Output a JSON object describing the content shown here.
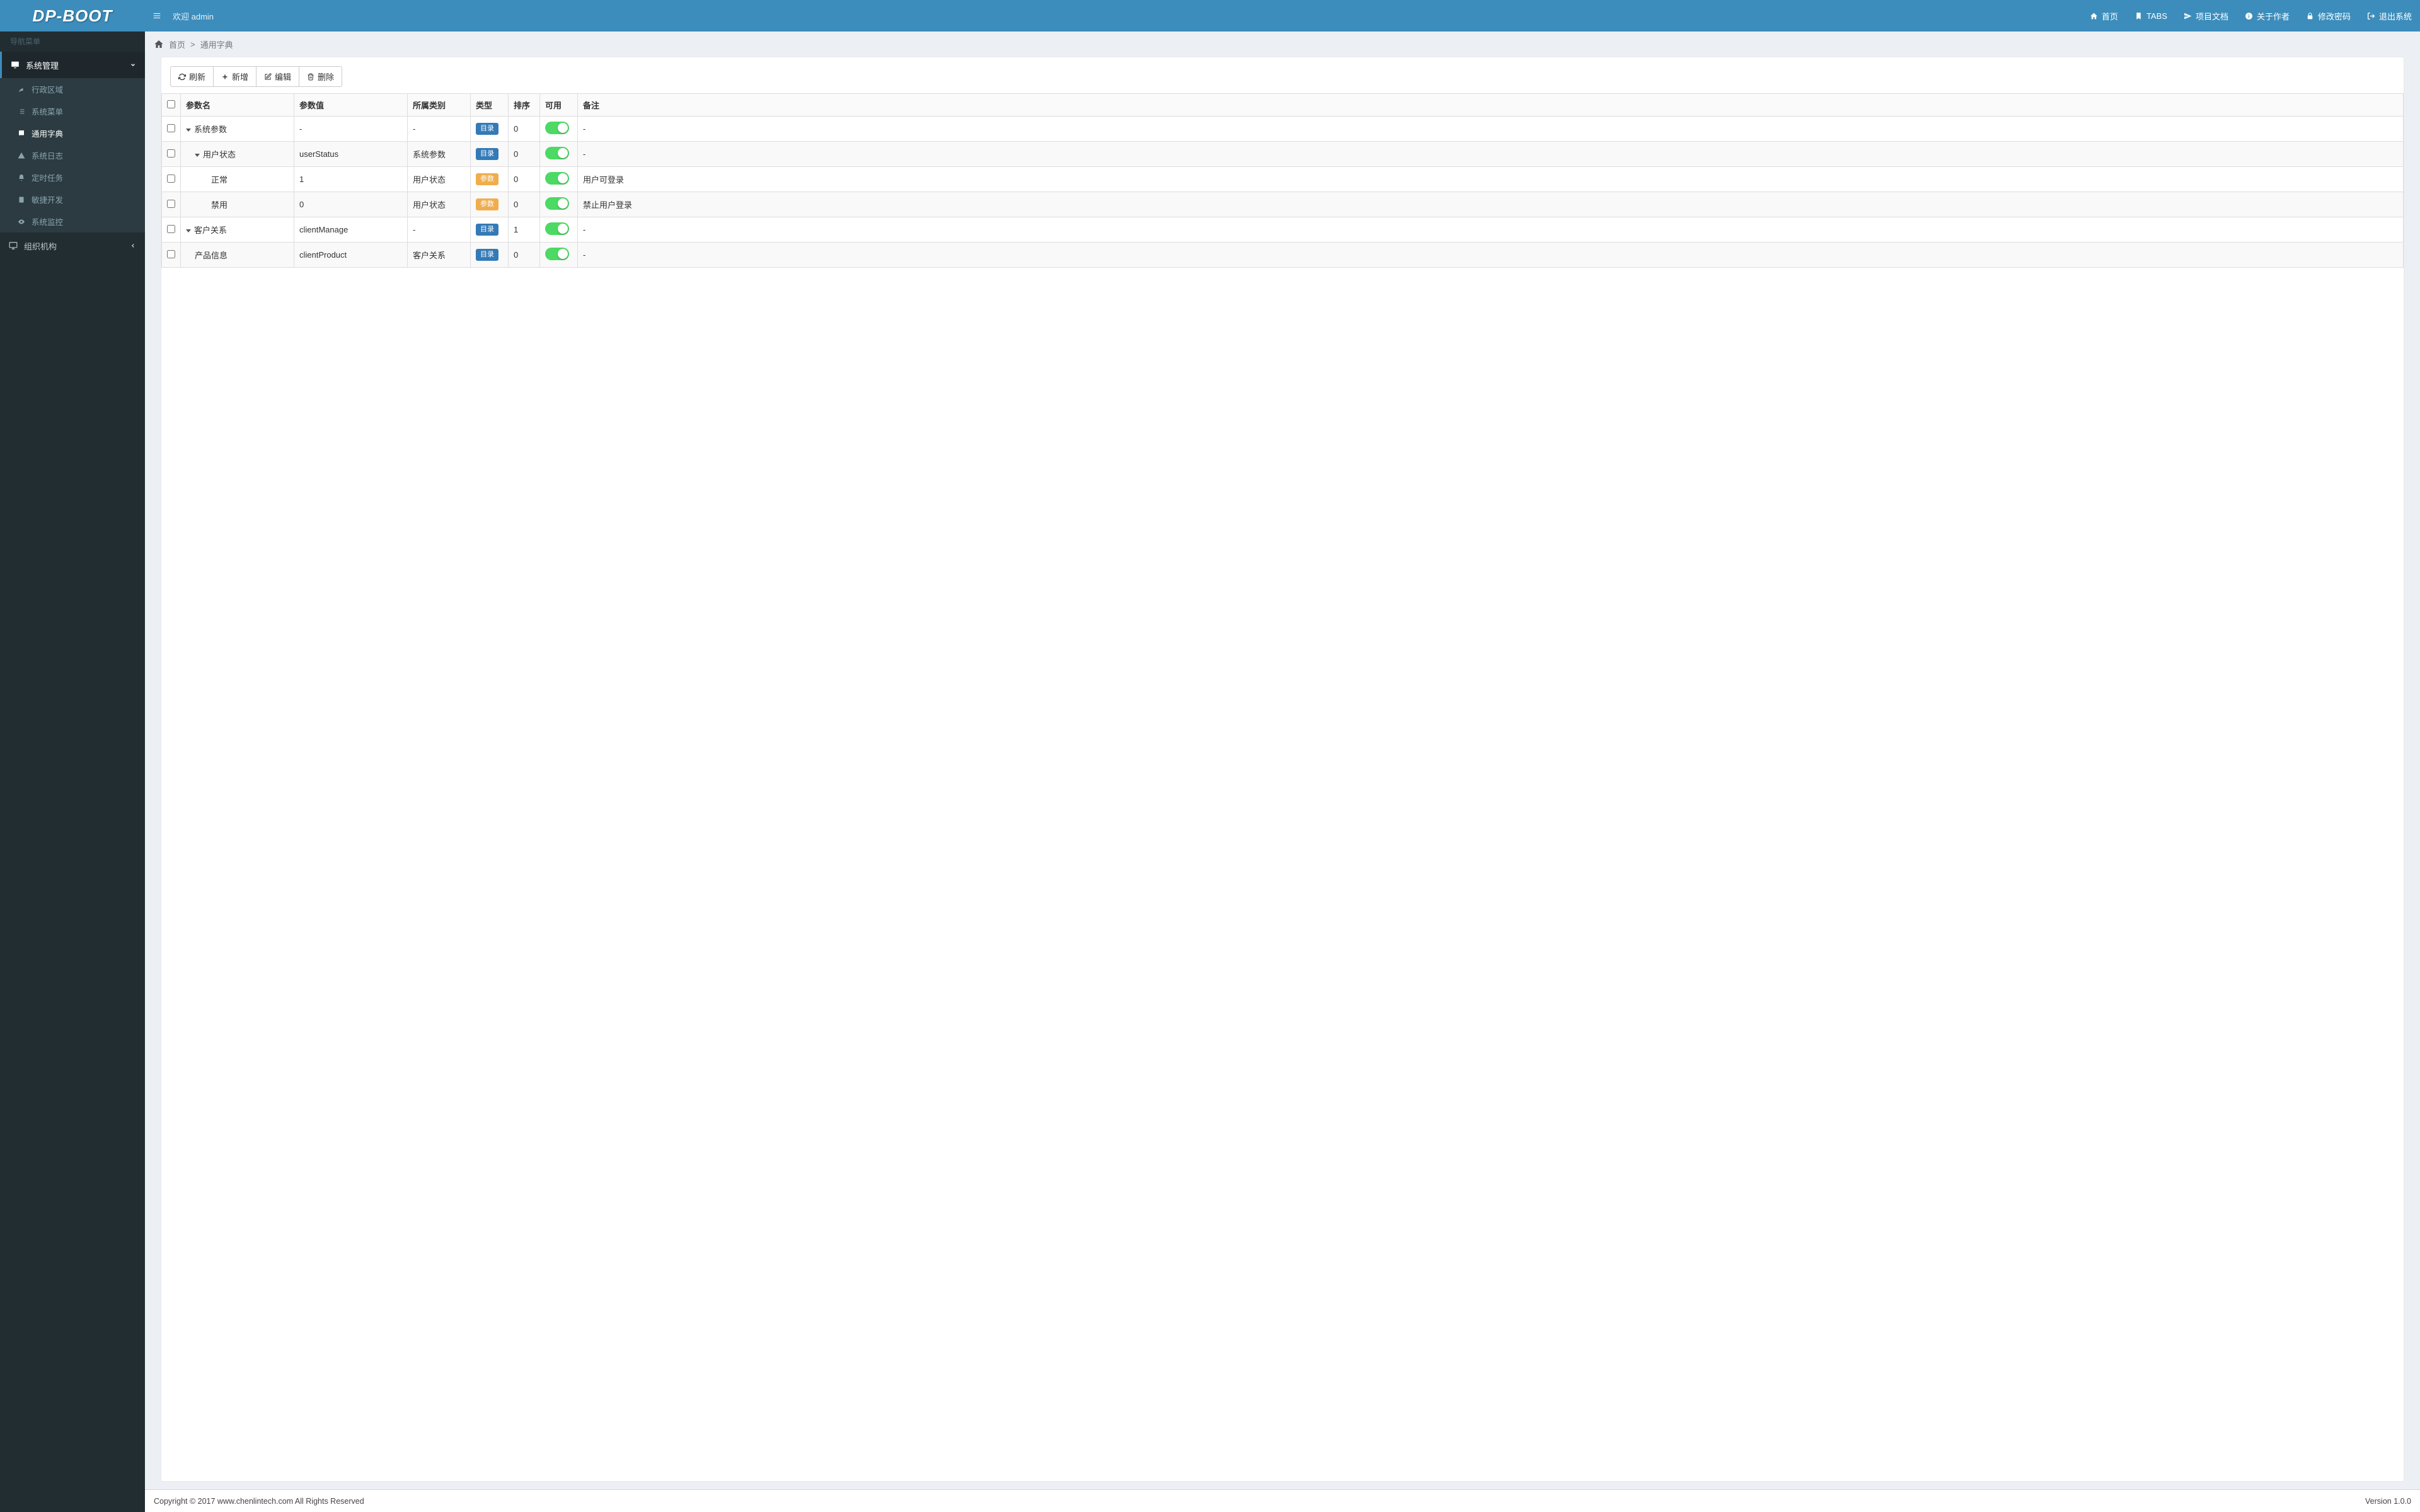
{
  "brand": "DP-BOOT",
  "header": {
    "welcome": "欢迎 admin",
    "nav": {
      "home": "首页",
      "tabs": "TABS",
      "docs": "项目文档",
      "about": "关于作者",
      "password": "修改密码",
      "logout": "退出系统"
    }
  },
  "sidebar": {
    "title": "导航菜单",
    "sys_manage": "系统管理",
    "items": [
      {
        "label": "行政区域"
      },
      {
        "label": "系统菜单"
      },
      {
        "label": "通用字典"
      },
      {
        "label": "系统日志"
      },
      {
        "label": "定时任务"
      },
      {
        "label": "敏捷开发"
      },
      {
        "label": "系统监控"
      }
    ],
    "org": "组织机构"
  },
  "breadcrumb": {
    "home": "首页",
    "sep": ">",
    "current": "通用字典"
  },
  "toolbar": {
    "refresh": "刷新",
    "add": "新增",
    "edit": "编辑",
    "delete": "删除"
  },
  "table": {
    "headers": {
      "name": "参数名",
      "value": "参数值",
      "category": "所属类别",
      "type": "类型",
      "sort": "排序",
      "enable": "可用",
      "remark": "备注"
    },
    "type_dir": "目录",
    "type_param": "参数",
    "rows": [
      {
        "indent": 0,
        "toggle": true,
        "name": "系统参数",
        "value": "-",
        "category": "-",
        "type": "dir",
        "sort": "0",
        "enable": true,
        "remark": "-"
      },
      {
        "indent": 1,
        "toggle": true,
        "name": "用户状态",
        "value": "userStatus",
        "category": "系统参数",
        "type": "dir",
        "sort": "0",
        "enable": true,
        "remark": "-"
      },
      {
        "indent": 2,
        "toggle": false,
        "name": "正常",
        "value": "1",
        "category": "用户状态",
        "type": "param",
        "sort": "0",
        "enable": true,
        "remark": "用户可登录"
      },
      {
        "indent": 2,
        "toggle": false,
        "name": "禁用",
        "value": "0",
        "category": "用户状态",
        "type": "param",
        "sort": "0",
        "enable": true,
        "remark": "禁止用户登录"
      },
      {
        "indent": 0,
        "toggle": true,
        "name": "客户关系",
        "value": "clientManage",
        "category": "-",
        "type": "dir",
        "sort": "1",
        "enable": true,
        "remark": "-"
      },
      {
        "indent": 1,
        "toggle": false,
        "name": "产品信息",
        "value": "clientProduct",
        "category": "客户关系",
        "type": "dir",
        "sort": "0",
        "enable": true,
        "remark": "-"
      }
    ]
  },
  "footer": {
    "copyright": "Copyright © 2017 www.chenlintech.com All Rights Reserved",
    "version": "Version 1.0.0"
  }
}
